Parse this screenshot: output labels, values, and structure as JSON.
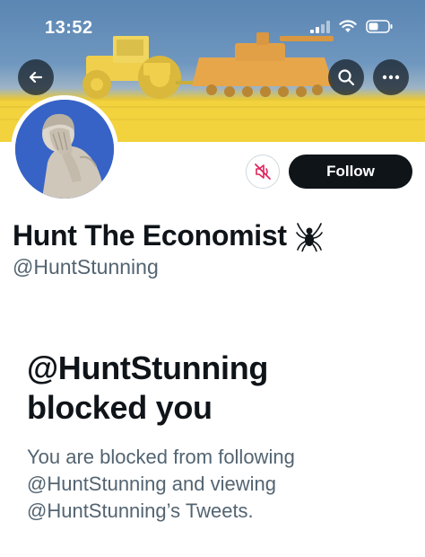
{
  "status_bar": {
    "time": "13:52",
    "icons": [
      "cellular-signal-icon",
      "wifi-icon",
      "battery-icon"
    ]
  },
  "header": {
    "back_icon": "arrow-left-icon",
    "search_icon": "search-icon",
    "more_icon": "more-horizontal-icon"
  },
  "profile": {
    "display_name": "Hunt The Economist",
    "name_emoji": "🕷",
    "handle": "@HuntStunning",
    "avatar_icon": "facepalm-statue-avatar"
  },
  "actions": {
    "mute_icon": "mute-notifications-icon",
    "follow_label": "Follow"
  },
  "blocked_notice": {
    "title_line1": "@HuntStunning",
    "title_line2": "blocked you",
    "desc_line1": "You are blocked from following",
    "desc_line2": "@HuntStunning and viewing",
    "desc_line3": "@HuntStunning’s Tweets."
  },
  "colors": {
    "accent_dark": "#0f1419",
    "secondary_text": "#536471",
    "banner_blue": "#6f97bf",
    "banner_yellow": "#f2d23d",
    "mute_red": "#e0245e"
  }
}
